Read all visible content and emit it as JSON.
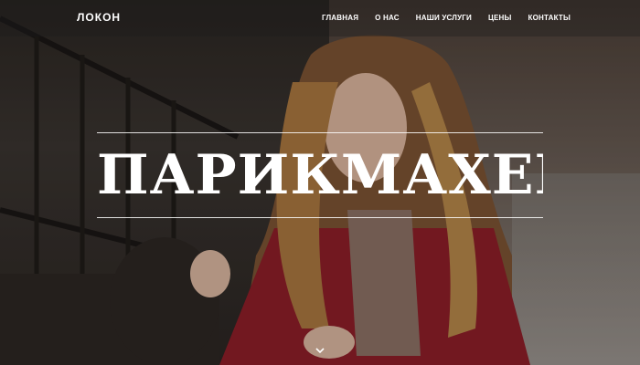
{
  "brand": {
    "name": "ЛОКОН"
  },
  "nav": {
    "items": [
      {
        "label": "ГЛАВНАЯ"
      },
      {
        "label": "О НАС"
      },
      {
        "label": "НАШИ УСЛУГИ"
      },
      {
        "label": "ЦЕНЫ"
      },
      {
        "label": "КОНТАКТЫ"
      }
    ]
  },
  "hero": {
    "headline": "ПАРИКМАХЕР",
    "scroll_icon": "chevron-down-icon"
  },
  "colors": {
    "text": "#ffffff",
    "navbar_bg": "rgba(30,30,30,0.35)",
    "rule": "#ffffff"
  }
}
